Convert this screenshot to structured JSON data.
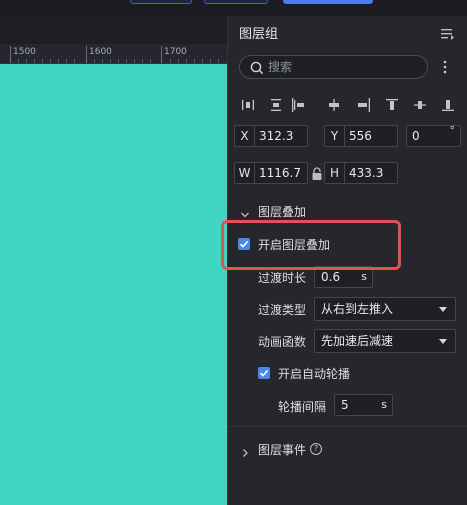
{
  "ruler": {
    "labels": [
      "1500",
      "1600",
      "1700"
    ]
  },
  "panel": {
    "title": "图层组",
    "search_placeholder": "搜索",
    "position": {
      "x_label": "X",
      "x_value": "312.3",
      "y_label": "Y",
      "y_value": "556",
      "rotation_value": "0",
      "rotation_unit": "°"
    },
    "size": {
      "w_label": "W",
      "w_value": "1116.7",
      "h_label": "H",
      "h_value": "433.3"
    },
    "overlay_section": {
      "title": "图层叠加",
      "enable_label": "开启图层叠加",
      "duration_label": "过渡时长",
      "duration_value": "0.6",
      "duration_unit": "s",
      "transition_type_label": "过渡类型",
      "transition_type_value": "从右到左推入",
      "easing_label": "动画函数",
      "easing_value": "先加速后减速",
      "autoplay_label": "开启自动轮播",
      "interval_label": "轮播间隔",
      "interval_value": "5",
      "interval_unit": "s"
    },
    "events_section": {
      "title": "图层事件",
      "help_glyph": "?"
    }
  },
  "colors": {
    "canvas": "#3fd6c6",
    "accent": "#4a86f0",
    "highlight": "#e2534f"
  }
}
